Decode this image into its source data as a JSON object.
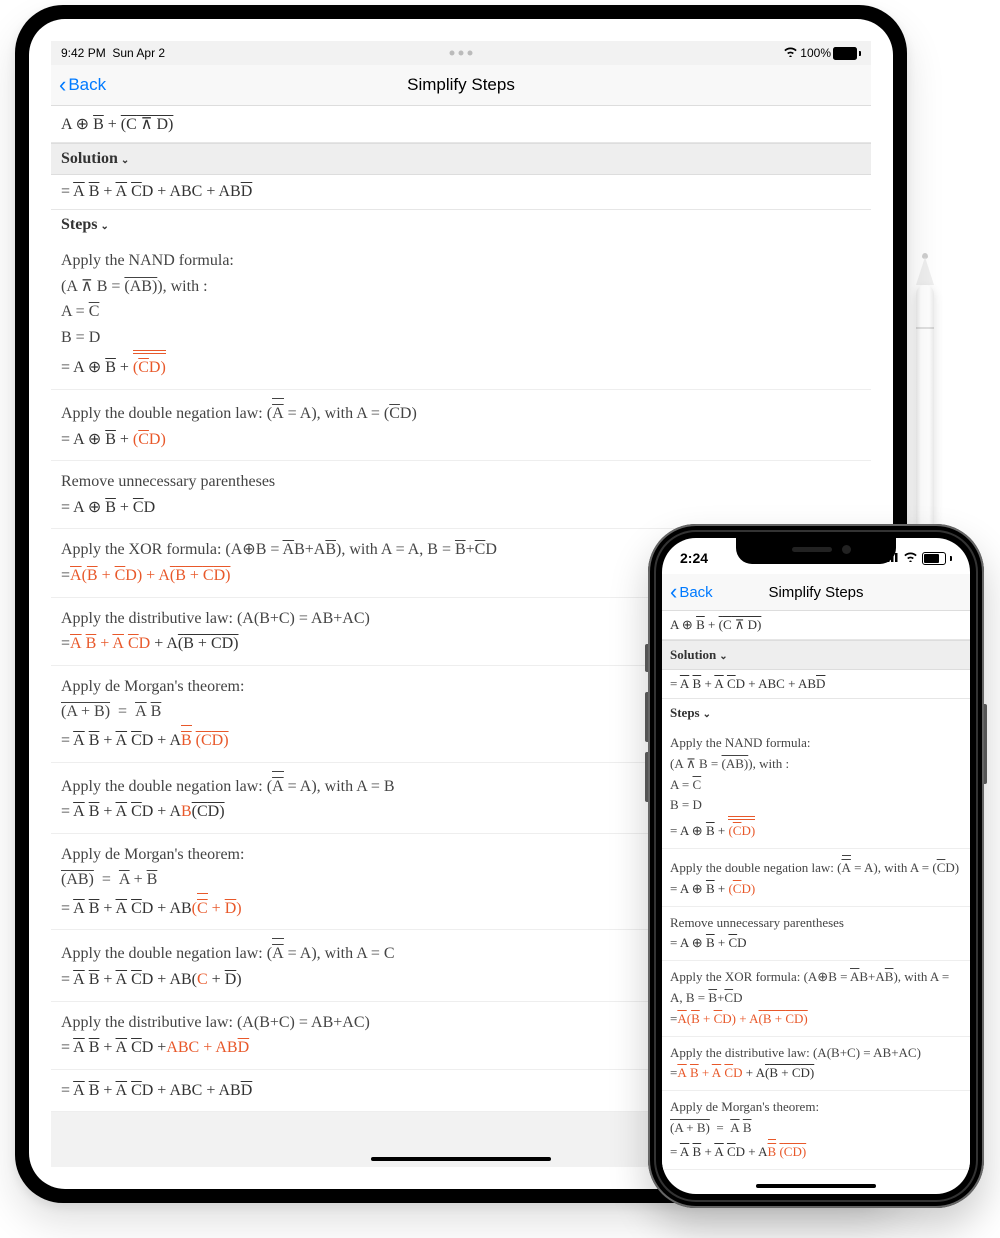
{
  "ipad": {
    "status": {
      "time": "9:42 PM",
      "date": "Sun Apr 2",
      "battery_pct": "100%"
    },
    "nav": {
      "back": "Back",
      "title": "Simplify Steps"
    },
    "input_expr": "A ⊕ B̅ + (C̅ ⊼ D)̅",
    "solution_label": "Solution",
    "solution_expr": "= A̅ B̅ + A̅ C̅D + ABC + ABD̅",
    "steps_label": "Steps",
    "steps": [
      {
        "desc_html": "Apply the NAND formula:<br>(A ⊼ B  =  <span class='over'>(AB)</span>), with :<br>A = <span class='over'>C</span><br>B = D",
        "expr_html": "= A ⊕ <span class='over'>B</span> + <span class='orange'><span class='dover2'><span class='dover'>(<span class='over'>C</span>D)</span></span></span>"
      },
      {
        "desc_html": "Apply the double negation law: (<span class='dover2'><span class='over'>A</span></span> = A), with A = (<span class='over'>C</span>D)",
        "expr_html": "= A ⊕ <span class='over'>B</span> + <span class='orange'>(<span class='over'>C</span>D)</span>"
      },
      {
        "desc_html": "Remove unnecessary parentheses",
        "expr_html": "= A ⊕ <span class='over'>B</span> + <span class='over'>C</span>D"
      },
      {
        "desc_html": "Apply the XOR formula: (A⊕B = <span class='over'>A</span>B+A<span class='over'>B</span>), with A = A, B = <span class='over'>B</span>+<span class='over'>C</span>D",
        "expr_html": "=<span class='orange'><span class='over'>A</span>(<span class='over'>B</span> + <span class='over'>C</span>D) + A<span class='over'>(<span class='over'>B</span> + <span class='over'>C</span>D)</span></span>"
      },
      {
        "desc_html": "Apply the distributive law: (A(B+C) = AB+AC)",
        "expr_html": "=<span class='orange'><span class='over'>A</span>&nbsp;<span class='over'>B</span> + <span class='over'>A</span>&nbsp;<span class='over'>C</span>D</span> + A<span class='over'>(<span class='over'>B</span> + <span class='over'>C</span>D)</span>"
      },
      {
        "desc_html": "Apply de Morgan's theorem:<br><span class='over'>(A + B)</span>&nbsp;&nbsp;=&nbsp;&nbsp;<span class='over'>A</span>&nbsp;<span class='over'>B</span>",
        "expr_html": "= <span class='over'>A</span>&nbsp;<span class='over'>B</span> + <span class='over'>A</span>&nbsp;<span class='over'>C</span>D + A<span class='orange'><span class='dover2'><span class='over'>B</span></span>&nbsp;<span class='over'>(<span class='over'>C</span>D)</span></span>"
      },
      {
        "desc_html": "Apply the double negation law: (<span class='dover2'><span class='over'>A</span></span> = A), with A = B",
        "expr_html": "= <span class='over'>A</span>&nbsp;<span class='over'>B</span> + <span class='over'>A</span>&nbsp;<span class='over'>C</span>D + A<span class='orange'>B</span><span class='over'>(<span class='over'>C</span>D)</span>"
      },
      {
        "desc_html": "Apply de Morgan's theorem:<br><span class='over'>(AB)</span>&nbsp;&nbsp;=&nbsp;&nbsp;<span class='over'>A</span> + <span class='over'>B</span>",
        "expr_html": "= <span class='over'>A</span>&nbsp;<span class='over'>B</span> + <span class='over'>A</span>&nbsp;<span class='over'>C</span>D + AB<span class='orange'>(<span class='dover2'><span class='over'>C</span></span> + <span class='over'>D</span>)</span>"
      },
      {
        "desc_html": "Apply the double negation law: (<span class='dover2'><span class='over'>A</span></span> = A), with A = C",
        "expr_html": "= <span class='over'>A</span>&nbsp;<span class='over'>B</span> + <span class='over'>A</span>&nbsp;<span class='over'>C</span>D + AB(<span class='orange'>C</span> + <span class='over'>D</span>)"
      },
      {
        "desc_html": "Apply the distributive law: (A(B+C) = AB+AC)",
        "expr_html": "= <span class='over'>A</span>&nbsp;<span class='over'>B</span> + <span class='over'>A</span>&nbsp;<span class='over'>C</span>D +<span class='orange'>ABC + AB<span class='over'>D</span></span>"
      },
      {
        "desc_html": "",
        "expr_html": "= <span class='over'>A</span>&nbsp;<span class='over'>B</span> + <span class='over'>A</span>&nbsp;<span class='over'>C</span>D + ABC + AB<span class='over'>D</span>"
      }
    ]
  },
  "iphone": {
    "status": {
      "time": "2:24"
    },
    "nav": {
      "back": "Back",
      "title": "Simplify Steps"
    },
    "input_expr": "A ⊕ B̅ + (C̅ ⊼ D)̅",
    "solution_label": "Solution",
    "solution_expr": "= A̅ B̅ + A̅ C̅D + ABC + ABD̅",
    "steps_label": "Steps",
    "steps": [
      {
        "desc_html": "Apply the NAND formula:<br>(A ⊼ B  =  <span class='over'>(AB)</span>), with :<br>A = <span class='over'>C</span><br>B = D",
        "expr_html": "= A ⊕ <span class='over'>B</span> + <span class='orange'><span class='dover2'><span class='dover'>(<span class='over'>C</span>D)</span></span></span>"
      },
      {
        "desc_html": "Apply the double negation law: (<span class='dover2'><span class='over'>A</span></span> = A), with A = (<span class='over'>C</span>D)",
        "expr_html": "= A ⊕ <span class='over'>B</span> + <span class='orange'>(<span class='over'>C</span>D)</span>"
      },
      {
        "desc_html": "Remove unnecessary parentheses",
        "expr_html": "= A ⊕ <span class='over'>B</span> + <span class='over'>C</span>D"
      },
      {
        "desc_html": "Apply the XOR formula: (A⊕B = <span class='over'>A</span>B+A<span class='over'>B</span>), with A = A, B = <span class='over'>B</span>+<span class='over'>C</span>D",
        "expr_html": "=<span class='orange'><span class='over'>A</span>(<span class='over'>B</span> + <span class='over'>C</span>D) + A<span class='over'>(<span class='over'>B</span> + <span class='over'>C</span>D)</span></span>"
      },
      {
        "desc_html": "Apply the distributive law: (A(B+C) = AB+AC)",
        "expr_html": "=<span class='orange'><span class='over'>A</span>&nbsp;<span class='over'>B</span> + <span class='over'>A</span>&nbsp;<span class='over'>C</span>D</span> + A<span class='over'>(<span class='over'>B</span> + <span class='over'>C</span>D)</span>"
      },
      {
        "desc_html": "Apply de Morgan's theorem:<br><span class='over'>(A + B)</span>&nbsp;&nbsp;=&nbsp;&nbsp;<span class='over'>A</span>&nbsp;<span class='over'>B</span>",
        "expr_html": "= <span class='over'>A</span>&nbsp;<span class='over'>B</span> + <span class='over'>A</span>&nbsp;<span class='over'>C</span>D + A<span class='orange'><span class='dover2'><span class='over'>B</span></span>&nbsp;<span class='over'>(<span class='over'>C</span>D)</span></span>"
      }
    ]
  }
}
